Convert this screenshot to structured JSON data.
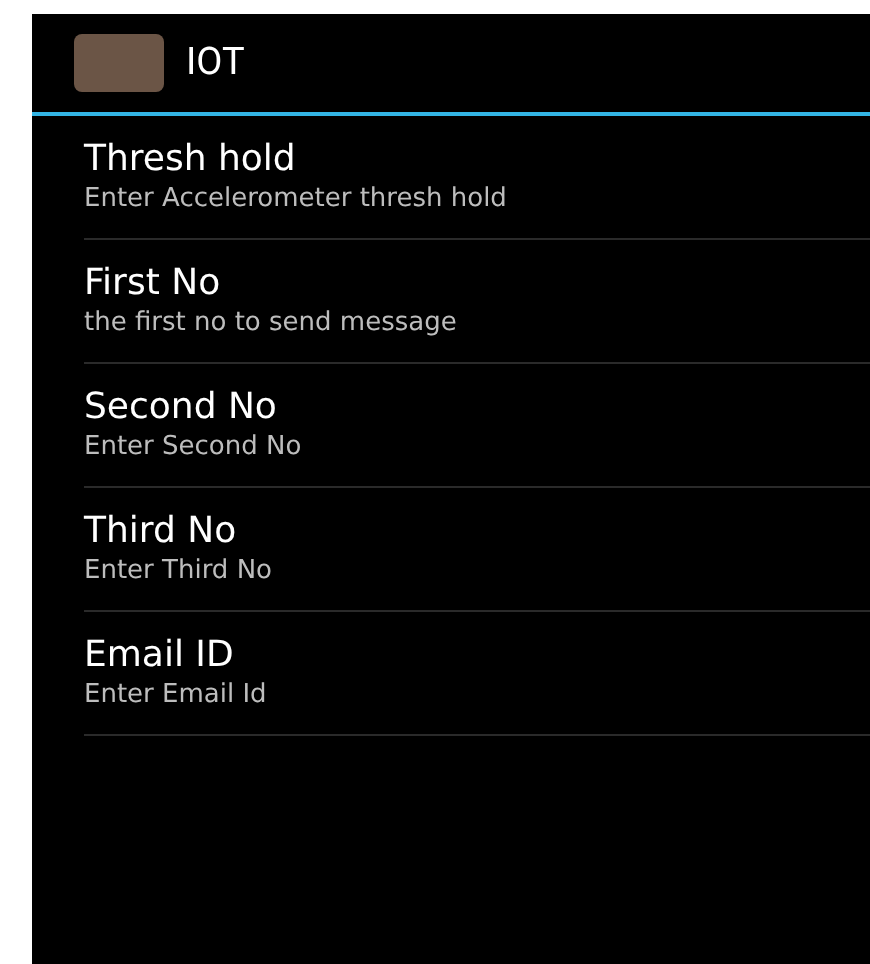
{
  "action_bar": {
    "title": "IOT"
  },
  "preferences": [
    {
      "title": "Thresh hold",
      "summary": "Enter Accelerometer thresh hold"
    },
    {
      "title": "First No",
      "summary": "the first no to send message"
    },
    {
      "title": "Second No",
      "summary": "Enter Second No"
    },
    {
      "title": "Third No",
      "summary": "Enter Third No"
    },
    {
      "title": "Email ID",
      "summary": "Enter Email Id"
    }
  ]
}
